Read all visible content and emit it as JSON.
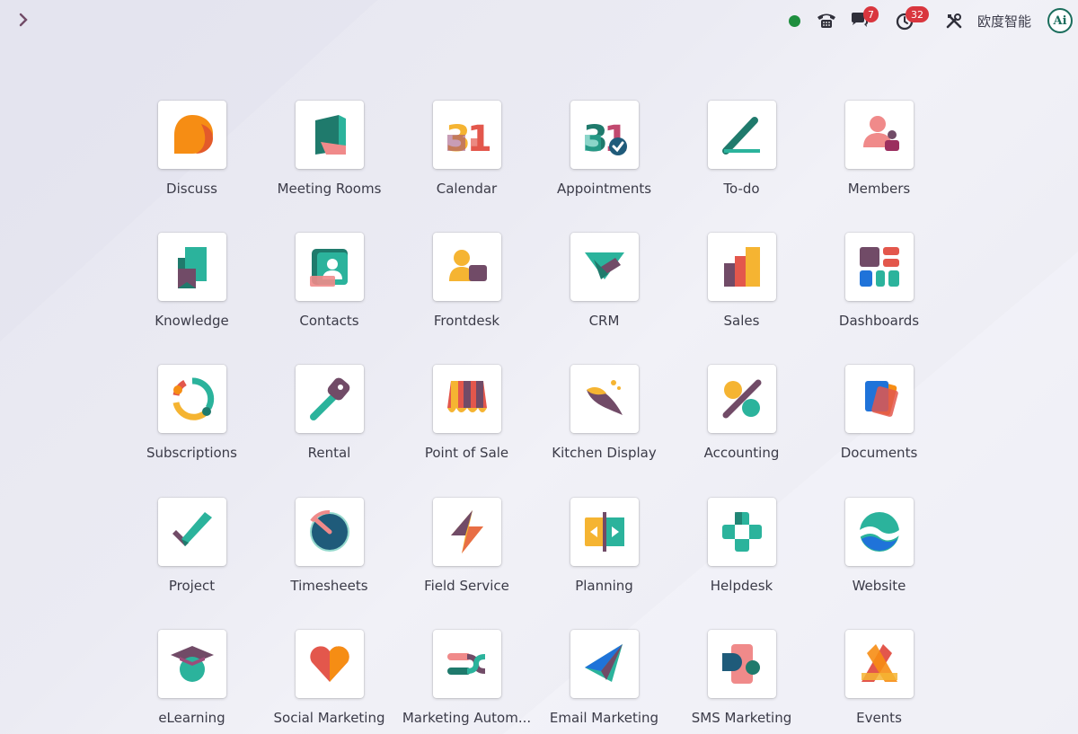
{
  "topbar": {
    "status": {
      "color": "#1e8e3e"
    },
    "messages_count": "7",
    "activities_count": "32",
    "company_name": "欧度智能",
    "avatar_text": "Ai"
  },
  "apps": [
    {
      "label": "Discuss",
      "icon": "discuss-icon"
    },
    {
      "label": "Meeting Rooms",
      "icon": "meeting-rooms-icon"
    },
    {
      "label": "Calendar",
      "icon": "calendar-icon"
    },
    {
      "label": "Appointments",
      "icon": "appointments-icon"
    },
    {
      "label": "To-do",
      "icon": "todo-icon"
    },
    {
      "label": "Members",
      "icon": "members-icon"
    },
    {
      "label": "Knowledge",
      "icon": "knowledge-icon"
    },
    {
      "label": "Contacts",
      "icon": "contacts-icon"
    },
    {
      "label": "Frontdesk",
      "icon": "frontdesk-icon"
    },
    {
      "label": "CRM",
      "icon": "crm-icon"
    },
    {
      "label": "Sales",
      "icon": "sales-icon"
    },
    {
      "label": "Dashboards",
      "icon": "dashboards-icon"
    },
    {
      "label": "Subscriptions",
      "icon": "subscriptions-icon"
    },
    {
      "label": "Rental",
      "icon": "rental-icon"
    },
    {
      "label": "Point of Sale",
      "icon": "point-of-sale-icon"
    },
    {
      "label": "Kitchen Display",
      "icon": "kitchen-display-icon"
    },
    {
      "label": "Accounting",
      "icon": "accounting-icon"
    },
    {
      "label": "Documents",
      "icon": "documents-icon"
    },
    {
      "label": "Project",
      "icon": "project-icon"
    },
    {
      "label": "Timesheets",
      "icon": "timesheets-icon"
    },
    {
      "label": "Field Service",
      "icon": "field-service-icon"
    },
    {
      "label": "Planning",
      "icon": "planning-icon"
    },
    {
      "label": "Helpdesk",
      "icon": "helpdesk-icon"
    },
    {
      "label": "Website",
      "icon": "website-icon"
    },
    {
      "label": "eLearning",
      "icon": "elearning-icon"
    },
    {
      "label": "Social Marketing",
      "icon": "social-marketing-icon"
    },
    {
      "label": "Marketing Autom...",
      "icon": "marketing-automation-icon"
    },
    {
      "label": "Email Marketing",
      "icon": "email-marketing-icon"
    },
    {
      "label": "SMS Marketing",
      "icon": "sms-marketing-icon"
    },
    {
      "label": "Events",
      "icon": "events-icon"
    }
  ]
}
